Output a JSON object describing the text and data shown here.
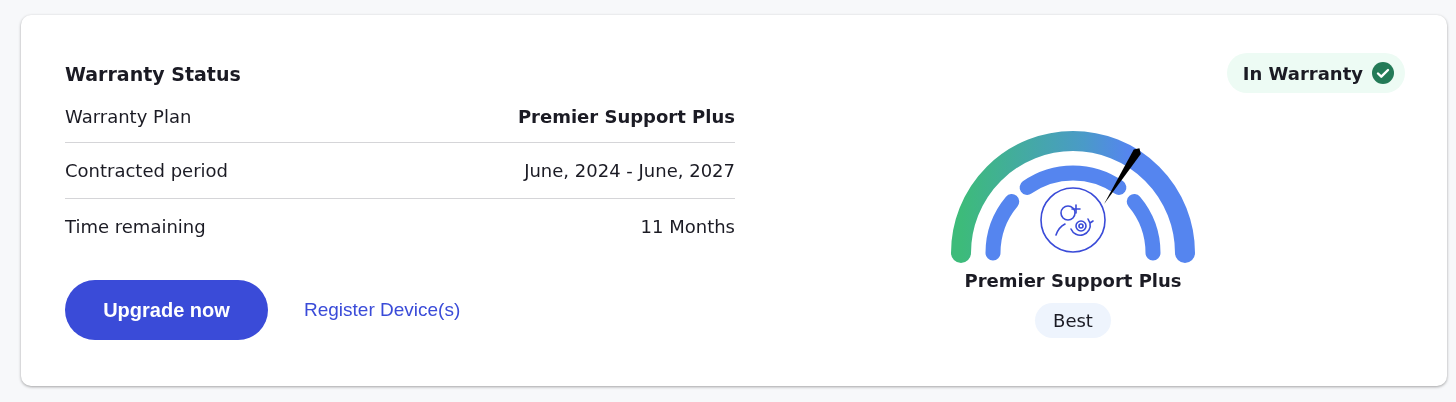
{
  "card": {
    "title": "Warranty Status",
    "status_badge": {
      "label": "In Warranty",
      "kind": "ok"
    },
    "rows": [
      {
        "label": "Warranty Plan",
        "value": "Premier Support Plus",
        "emphasis": true
      },
      {
        "label": "Contracted period",
        "value": "June, 2024 - June, 2027",
        "emphasis": false
      },
      {
        "label": "Time remaining",
        "value": "11 Months",
        "emphasis": false
      }
    ],
    "primary_button": "Upgrade now",
    "link": "Register Device(s)",
    "gauge": {
      "plan": "Premier Support Plus",
      "tier": "Best"
    }
  }
}
